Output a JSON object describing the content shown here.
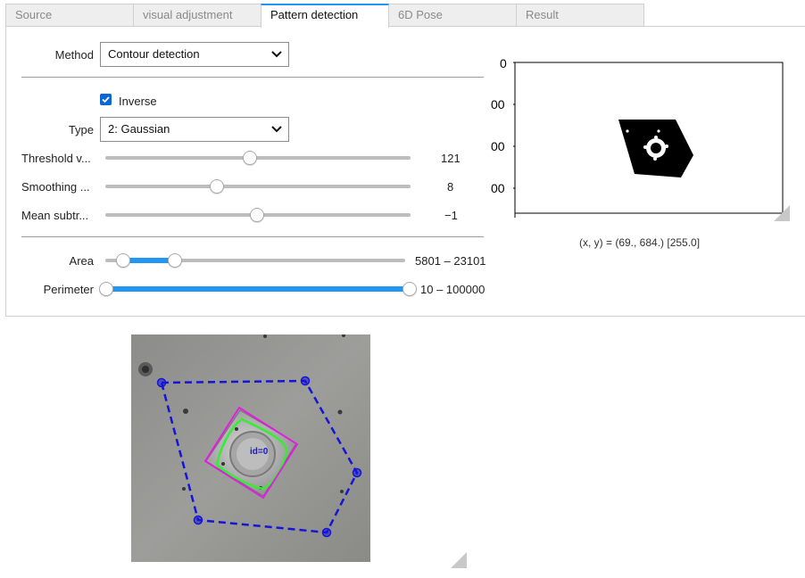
{
  "tabs": [
    {
      "label": "Source",
      "active": false
    },
    {
      "label": "visual adjustment",
      "active": false
    },
    {
      "label": "Pattern detection",
      "active": true
    },
    {
      "label": "6D Pose",
      "active": false
    },
    {
      "label": "Result",
      "active": false
    }
  ],
  "method": {
    "label": "Method",
    "value": "Contour detection"
  },
  "inverse": {
    "label": "Inverse",
    "checked": true
  },
  "type": {
    "label": "Type",
    "value": "2: Gaussian"
  },
  "sliders": [
    {
      "label": "Threshold v...",
      "value": "121"
    },
    {
      "label": "Smoothing ...",
      "value": "8"
    },
    {
      "label": "Mean subtr...",
      "value": "−1"
    }
  ],
  "ranges": [
    {
      "label": "Area",
      "value": "5801 – 23101"
    },
    {
      "label": "Perimeter",
      "value": "10 – 100000"
    }
  ],
  "plot": {
    "yticks": [
      "0",
      "00",
      "00",
      "00"
    ],
    "coord_readout": "(x, y) = (69., 684.) [255.0]"
  },
  "detection": {
    "id_label": "id=0",
    "colors": {
      "hull": "#1515d6",
      "bbox": "#e020e0",
      "contour": "#33ee33"
    }
  },
  "colors": {
    "accent": "#2196f3",
    "checkbox": "#0a66d8"
  }
}
